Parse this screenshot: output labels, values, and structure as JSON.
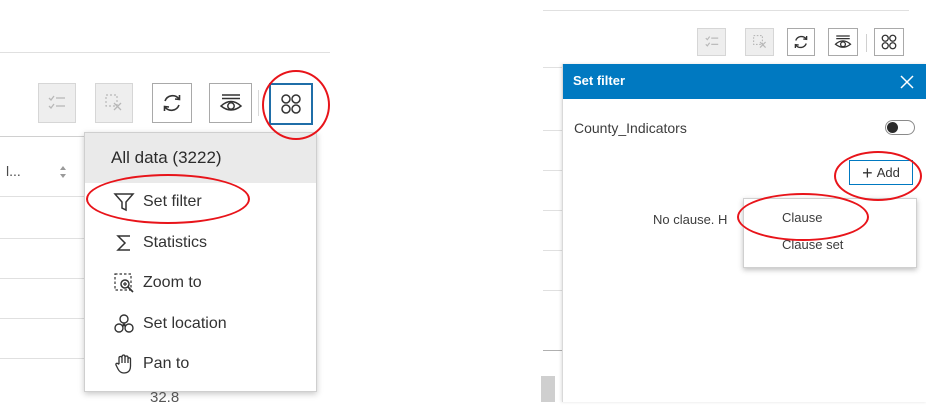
{
  "left": {
    "col_header_partial": "l...",
    "cell_partial": "32.8",
    "menu": {
      "header": "All data (3222)",
      "items": [
        {
          "label": "Set filter",
          "icon": "filter-icon"
        },
        {
          "label": "Statistics",
          "icon": "sigma-icon"
        },
        {
          "label": "Zoom to",
          "icon": "zoom-to-icon"
        },
        {
          "label": "Set location",
          "icon": "set-location-icon"
        },
        {
          "label": "Pan to",
          "icon": "pan-hand-icon"
        }
      ]
    }
  },
  "right": {
    "panel": {
      "title": "Set filter",
      "layer_name": "County_Indicators",
      "add_label": "Add",
      "no_clause_text": "No clause. H",
      "dropdown": [
        "Clause",
        "Clause set"
      ]
    }
  },
  "colors": {
    "accent_blue": "#0079c1",
    "highlight_red": "#e8141a",
    "active_border": "#1f6ea8"
  }
}
